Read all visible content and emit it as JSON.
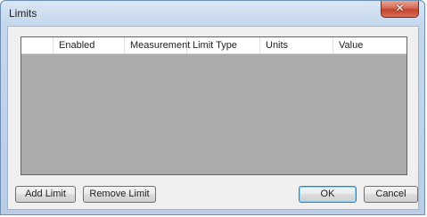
{
  "window": {
    "title": "Limits",
    "close_icon": "close-icon"
  },
  "grid": {
    "columns": [
      "",
      "Enabled",
      "Measurement",
      "Limit Type",
      "Units",
      "Value"
    ],
    "rows": [],
    "background_color": "#ababab"
  },
  "buttons": {
    "add_limit": "Add Limit",
    "remove_limit": "Remove Limit",
    "ok": "OK",
    "cancel": "Cancel"
  },
  "colors": {
    "close_button": "#c2422b",
    "title_bar": "#c4d7ec"
  }
}
